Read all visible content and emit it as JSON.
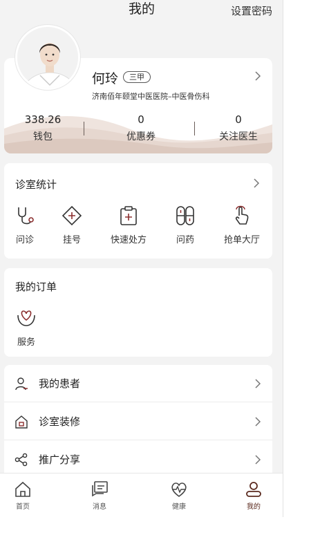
{
  "header": {
    "title": "我的",
    "set_password": "设置密码"
  },
  "profile": {
    "name": "何玲",
    "level_badge": "三甲",
    "hospital": "济南佰年颐堂中医医院–中医骨伤科",
    "stats": [
      {
        "value": "338.26",
        "label": "钱包"
      },
      {
        "value": "0",
        "label": "优惠券"
      },
      {
        "value": "0",
        "label": "关注医生"
      }
    ]
  },
  "clinic_stats": {
    "title": "诊室统计",
    "tools": [
      {
        "label": "问诊",
        "icon": "stethoscope-icon"
      },
      {
        "label": "挂号",
        "icon": "register-icon"
      },
      {
        "label": "快速处方",
        "icon": "prescription-icon"
      },
      {
        "label": "问药",
        "icon": "pills-icon"
      },
      {
        "label": "抢单大厅",
        "icon": "tap-hand-icon"
      }
    ]
  },
  "orders": {
    "title": "我的订单",
    "items": [
      {
        "label": "服务",
        "icon": "heart-hands-icon"
      }
    ]
  },
  "menu": [
    {
      "label": "我的患者",
      "icon": "patient-icon"
    },
    {
      "label": "诊室装修",
      "icon": "house-icon"
    },
    {
      "label": "推广分享",
      "icon": "share-icon"
    }
  ],
  "tabbar": [
    {
      "label": "首页",
      "icon": "home-icon",
      "active": false
    },
    {
      "label": "消息",
      "icon": "message-icon",
      "active": false
    },
    {
      "label": "健康",
      "icon": "health-heart-icon",
      "active": false
    },
    {
      "label": "我的",
      "icon": "user-icon",
      "active": true
    }
  ],
  "colors": {
    "accent": "#5b2a1f",
    "background": "#f3f3f3",
    "card": "#ffffff",
    "wave": "#e9ddd6"
  }
}
